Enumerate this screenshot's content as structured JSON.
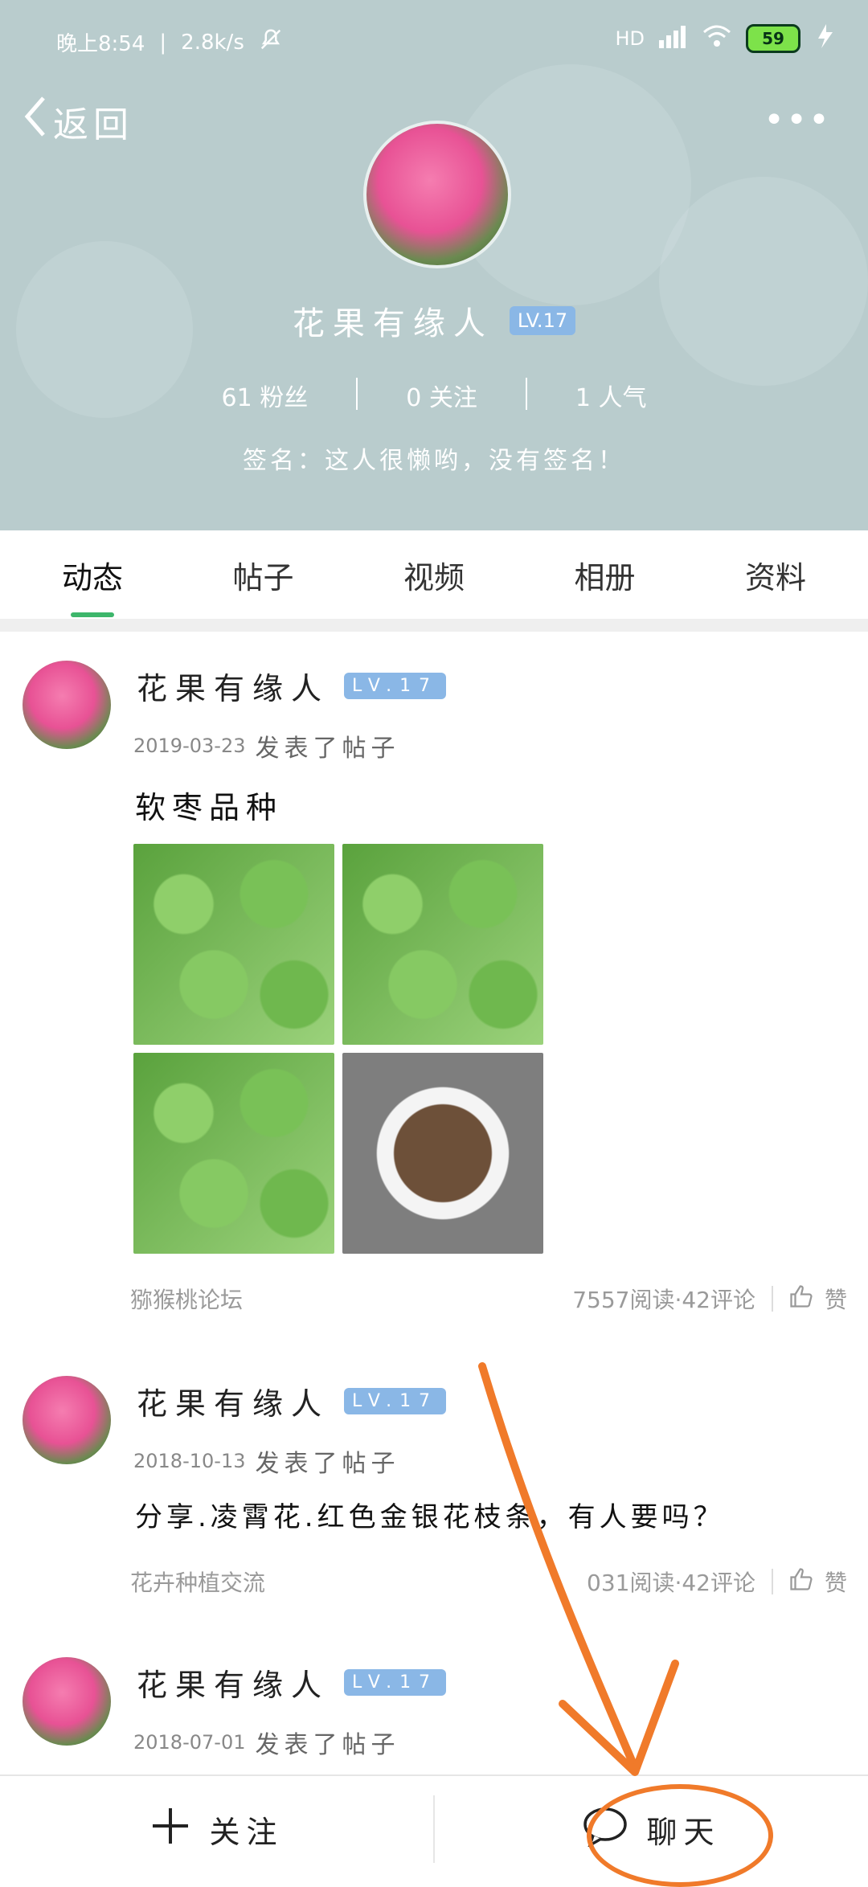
{
  "status_bar": {
    "time": "晚上8:54",
    "speed": "2.8k/s",
    "network": "HD",
    "battery": "59"
  },
  "nav": {
    "back_label": "返回",
    "more_label": "•••"
  },
  "profile": {
    "name": "花果有缘人",
    "level": "LV.17",
    "stats": [
      {
        "label": "61 粉丝"
      },
      {
        "label": "0 关注"
      },
      {
        "label": "1 人气"
      }
    ],
    "signature": "签名：这人很懒哟，没有签名！"
  },
  "tabs": [
    {
      "label": "动态",
      "active": true
    },
    {
      "label": "帖子",
      "active": false
    },
    {
      "label": "视频",
      "active": false
    },
    {
      "label": "相册",
      "active": false
    },
    {
      "label": "资料",
      "active": false
    }
  ],
  "posts": [
    {
      "author": "花果有缘人",
      "level": "LV.17",
      "date": "2019-03-23",
      "action": "发表了帖子",
      "title": "软枣品种",
      "forum": "猕猴桃论坛",
      "stats": "7557阅读·42评论",
      "like_label": "赞"
    },
    {
      "author": "花果有缘人",
      "level": "LV.17",
      "date": "2018-10-13",
      "action": "发表了帖子",
      "title": "分享.凌霄花.红色金银花枝条，有人要吗？",
      "forum": "花卉种植交流",
      "stats": "031阅读·42评论",
      "like_label": "赞"
    },
    {
      "author": "花果有缘人",
      "level": "LV.17",
      "date": "2018-07-01",
      "action": "发表了帖子"
    }
  ],
  "bottom_bar": {
    "follow_label": "关注",
    "chat_label": "聊天"
  },
  "colors": {
    "header_bg": "#b9cccd",
    "accent_green": "#3db66b",
    "level_badge": "#8ab7e6",
    "annotation_orange": "#f07a2a"
  }
}
